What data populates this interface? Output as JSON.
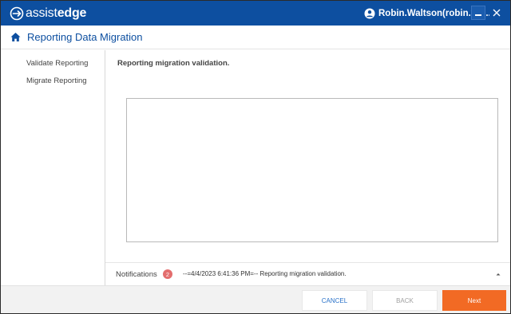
{
  "app": {
    "logo_light": "assist",
    "logo_bold": "edge",
    "user_name": "Robin.Waltson(robin.wa...",
    "brand_color": "#0d4fa0"
  },
  "header": {
    "title": "Reporting Data Migration",
    "icon": "home-icon"
  },
  "sidebar": {
    "items": [
      {
        "label": "Validate Reporting"
      },
      {
        "label": "Migrate Reporting"
      }
    ]
  },
  "main": {
    "heading": "Reporting migration validation.",
    "log_text": ""
  },
  "notifications": {
    "label": "Notifications",
    "count": "2",
    "message": "--=4/4/2023  6:41:36 PM=-- Reporting migration validation."
  },
  "footer": {
    "cancel_label": "CANCEL",
    "back_label": "BACK",
    "next_label": "Next",
    "accent_color": "#f26a24"
  }
}
